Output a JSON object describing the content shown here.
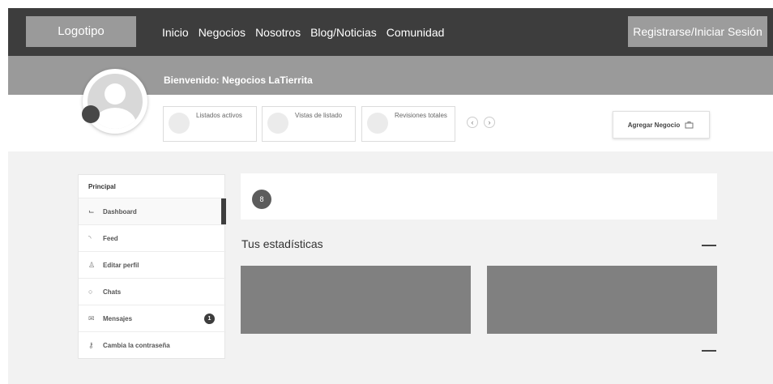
{
  "header": {
    "logo_label": "Logotipo",
    "nav": [
      "Inicio",
      "Negocios",
      "Nosotros",
      "Blog/Noticias",
      "Comunidad"
    ],
    "register_label": "Registrarse/Iniciar Sesión"
  },
  "profile": {
    "welcome": "Bienvenido: Negocios LaTierrita",
    "stats": [
      {
        "label": "Listados activos"
      },
      {
        "label": "Vistas de listado"
      },
      {
        "label": "Revisiones totales"
      }
    ],
    "prev_arrow": "‹",
    "next_arrow": "›",
    "add_business_label": "Agregar Negocio"
  },
  "sidebar": {
    "title": "Principal",
    "items": [
      {
        "label": "Dashboard",
        "icon": "chart-icon"
      },
      {
        "label": "Feed",
        "icon": "rss-icon"
      },
      {
        "label": "Editar perfil",
        "icon": "user-edit-icon"
      },
      {
        "label": "Chats",
        "icon": "chat-icon"
      },
      {
        "label": "Mensajes",
        "icon": "mail-icon",
        "badge": "1"
      },
      {
        "label": "Cambia la contraseña",
        "icon": "key-icon"
      }
    ]
  },
  "main": {
    "panel_icon_text": "8",
    "stats_heading": "Tus estadísticas"
  },
  "colors": {
    "header_bg": "#3d3d3d",
    "banner_bg": "#9a9a9a",
    "content_bg": "#f2f2f2",
    "stat_box": "#808080"
  }
}
